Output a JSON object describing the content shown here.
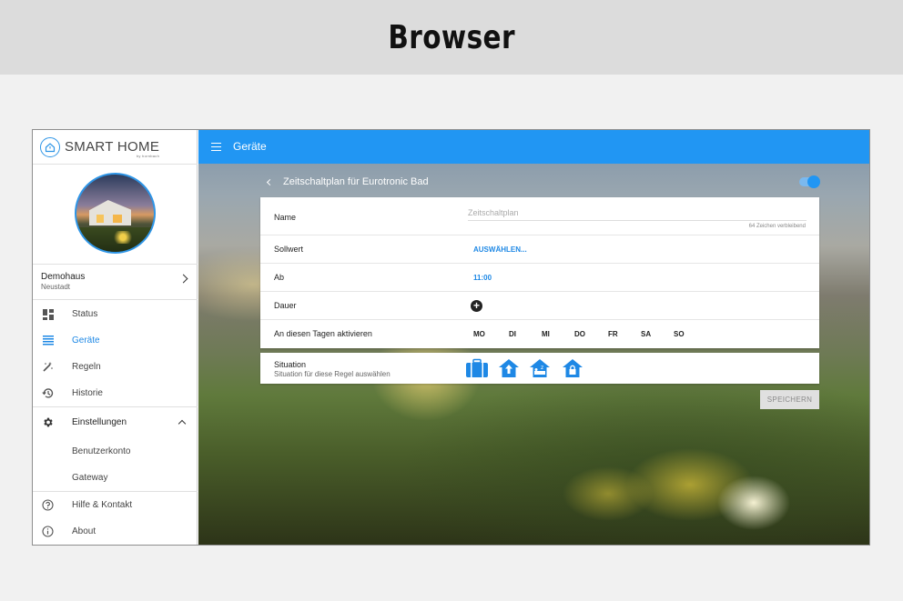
{
  "banner": {
    "title": "Browser"
  },
  "logo": {
    "text": "SMART HOME",
    "sub": "by hornbach"
  },
  "location": {
    "name": "Demohaus",
    "city": "Neustadt"
  },
  "nav": {
    "status": "Status",
    "geraete": "Geräte",
    "regeln": "Regeln",
    "historie": "Historie",
    "einstellungen": "Einstellungen",
    "benutzerkonto": "Benutzerkonto",
    "gateway": "Gateway",
    "hilfe": "Hilfe & Kontakt",
    "about": "About",
    "active": "geraete"
  },
  "appbar": {
    "title": "Geräte"
  },
  "schedule": {
    "title": "Zeitschaltplan für Eurotronic Bad",
    "enabled": true,
    "name_label": "Name",
    "name_placeholder": "Zeitschaltplan",
    "name_counter": "64 Zeichen verbleibend",
    "sollwert_label": "Sollwert",
    "sollwert_value": "AUSWÄHLEN...",
    "ab_label": "Ab",
    "ab_value": "11:00",
    "dauer_label": "Dauer",
    "days_label": "An diesen Tagen aktivieren",
    "days": [
      "MO",
      "DI",
      "MI",
      "DO",
      "FR",
      "SA",
      "SO"
    ],
    "situation_label": "Situation",
    "situation_sub": "Situation für diese Regel auswählen",
    "situation_icons": [
      "suitcase-icon",
      "home-arrow-icon",
      "home-sleep-icon",
      "home-lock-icon"
    ],
    "save_label": "SPEICHERN"
  },
  "colors": {
    "primary": "#2196f3",
    "link": "#1e88e5"
  }
}
